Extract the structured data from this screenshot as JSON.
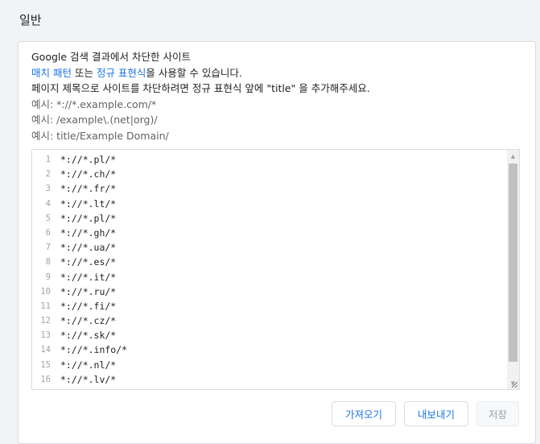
{
  "section": {
    "title": "일반"
  },
  "description": {
    "line1": "Google 검색 결과에서 차단한 사이트",
    "match_pattern_link": "매치 패턴",
    "or_text": " 또는 ",
    "regex_link": "정규 표현식",
    "usable_text": "을 사용할 수 있습니다.",
    "line3": "페이지 제목으로 사이트를 차단하려면 정규 표현식 앞에 \"title\" 을 추가해주세요.",
    "examples": [
      "예시: *://*.example.com/*",
      "예시: /example\\.(net|org)/",
      "예시: title/Example Domain/"
    ]
  },
  "editor": {
    "lines": [
      {
        "num": "1",
        "text": "*://*.pl/*"
      },
      {
        "num": "2",
        "text": "*://*.ch/*"
      },
      {
        "num": "3",
        "text": "*://*.fr/*"
      },
      {
        "num": "4",
        "text": "*://*.lt/*"
      },
      {
        "num": "5",
        "text": "*://*.pl/*"
      },
      {
        "num": "6",
        "text": "*://*.gh/*"
      },
      {
        "num": "7",
        "text": "*://*.ua/*"
      },
      {
        "num": "8",
        "text": "*://*.es/*"
      },
      {
        "num": "9",
        "text": "*://*.it/*"
      },
      {
        "num": "10",
        "text": "*://*.ru/*"
      },
      {
        "num": "11",
        "text": "*://*.fi/*"
      },
      {
        "num": "12",
        "text": "*://*.cz/*"
      },
      {
        "num": "13",
        "text": "*://*.sk/*"
      },
      {
        "num": "14",
        "text": "*://*.info/*"
      },
      {
        "num": "15",
        "text": "*://*.nl/*"
      },
      {
        "num": "16",
        "text": "*://*.lv/*"
      }
    ]
  },
  "buttons": {
    "import_label": "가져오기",
    "export_label": "내보내기",
    "save_label": "저장"
  },
  "colors": {
    "link": "#1a73e8",
    "background": "#f1f3f4",
    "card": "#ffffff",
    "border": "#dadce0"
  }
}
